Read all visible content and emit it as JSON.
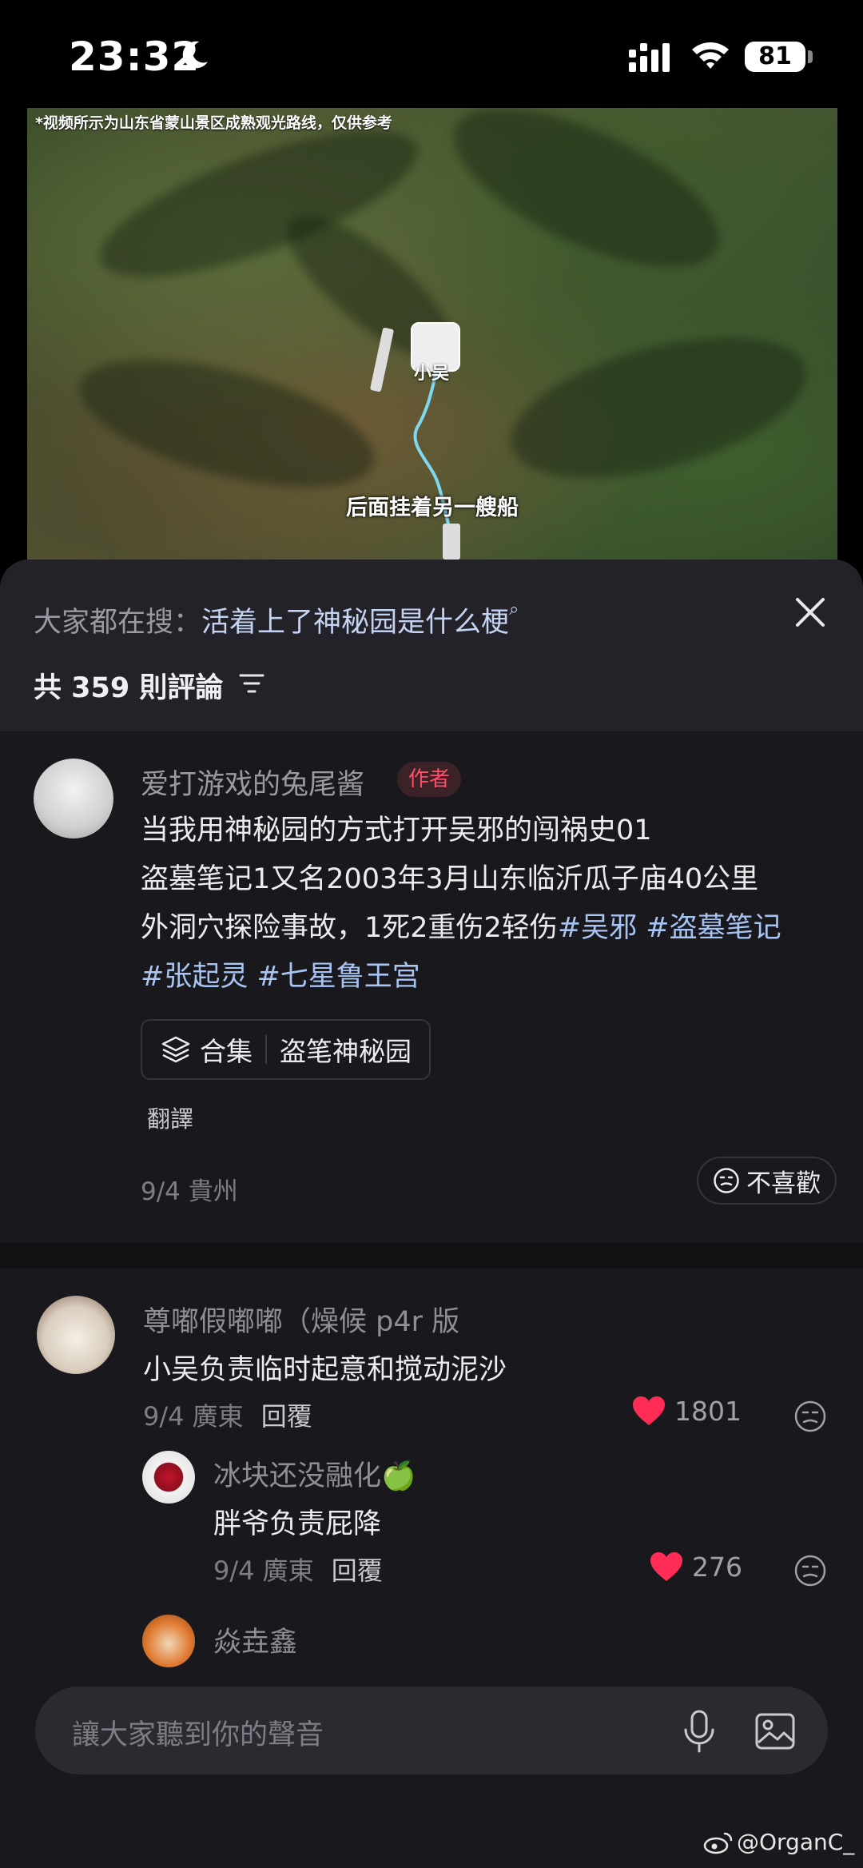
{
  "status_bar": {
    "time": "23:32",
    "battery": "81"
  },
  "video": {
    "notice": "*视频所示为山东省蒙山景区成熟观光路线，仅供参考",
    "character_label": "小吴",
    "subtitle": "后面挂着另一艘船"
  },
  "sheet": {
    "search_prefix": "大家都在搜：",
    "search_query": "活着上了神秘园是什么梗",
    "comment_count": "共 359 則評論"
  },
  "author_post": {
    "name": "爱打游戏的兔尾酱",
    "badge": "作者",
    "line1": "当我用神秘园的方式打开吴邪的闯祸史01",
    "line2": "盗墓笔记1又名2003年3月山东临沂瓜子庙40公里",
    "line3_text": "外洞穴探险事故，1死2重伤2轻伤",
    "line3_tags": "#吴邪 #盗墓笔记",
    "line4_tags": "#张起灵 #七星鲁王宫",
    "collection_label": "合集",
    "collection_name": "盗笔神秘园",
    "translate": "翻譯",
    "meta": "9/4 貴州",
    "dislike": "不喜歡"
  },
  "comments": [
    {
      "name": "尊嘟假嘟嘟（燥候 p4r 版",
      "text": "小吴负责临时起意和搅动泥沙",
      "meta": "9/4 廣東",
      "reply": "回覆",
      "likes": "1801"
    },
    {
      "name": "冰块还没融化🍏",
      "text": "胖爷负责屁降",
      "meta": "9/4 廣東",
      "reply": "回覆",
      "likes": "276"
    },
    {
      "name": "焱垚鑫"
    }
  ],
  "input": {
    "placeholder": "讓大家聽到你的聲音"
  },
  "watermark": "@OrganC_",
  "colors": {
    "accent_red": "#ff2d55",
    "tag_blue": "#a8c4f2",
    "badge_red": "#ff4d6a"
  }
}
